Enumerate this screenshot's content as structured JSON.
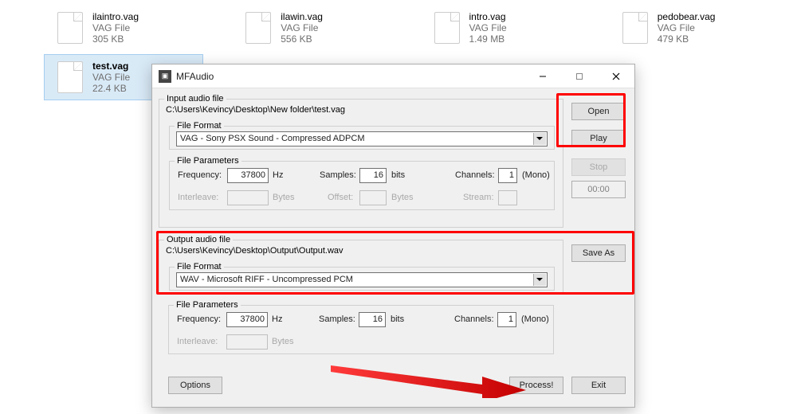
{
  "files": [
    {
      "name": "ilaintro.vag",
      "type": "VAG File",
      "size": "305 KB"
    },
    {
      "name": "ilawin.vag",
      "type": "VAG File",
      "size": "556 KB"
    },
    {
      "name": "intro.vag",
      "type": "VAG File",
      "size": "1.49 MB"
    },
    {
      "name": "pedobear.vag",
      "type": "VAG File",
      "size": "479 KB"
    },
    {
      "name": "test.vag",
      "type": "VAG File",
      "size": "22.4 KB"
    }
  ],
  "window": {
    "title": "MFAudio",
    "input": {
      "legend": "Input audio file",
      "path": "C:\\Users\\Kevincy\\Desktop\\New folder\\test.vag",
      "fileformat_legend": "File Format",
      "fileformat_value": "VAG - Sony PSX Sound - Compressed ADPCM",
      "params_legend": "File Parameters",
      "freq_label": "Frequency:",
      "freq_value": "37800",
      "freq_unit": "Hz",
      "samples_label": "Samples:",
      "samples_value": "16",
      "samples_unit": "bits",
      "channels_label": "Channels:",
      "channels_value": "1",
      "channels_unit": "(Mono)",
      "interleave_label": "Interleave:",
      "interleave_unit": "Bytes",
      "offset_label": "Offset:",
      "offset_unit": "Bytes",
      "stream_label": "Stream:"
    },
    "output": {
      "legend": "Output audio file",
      "path": "C:\\Users\\Kevincy\\Desktop\\Output\\Output.wav",
      "fileformat_legend": "File Format",
      "fileformat_value": "WAV - Microsoft RIFF - Uncompressed PCM",
      "params_legend": "File Parameters",
      "freq_label": "Frequency:",
      "freq_value": "37800",
      "freq_unit": "Hz",
      "samples_label": "Samples:",
      "samples_value": "16",
      "samples_unit": "bits",
      "channels_label": "Channels:",
      "channels_value": "1",
      "channels_unit": "(Mono)",
      "interleave_label": "Interleave:",
      "interleave_unit": "Bytes"
    },
    "buttons": {
      "open": "Open",
      "play": "Play",
      "stop": "Stop",
      "time": "00:00",
      "saveas": "Save As",
      "options": "Options",
      "process": "Process!",
      "exit": "Exit"
    }
  }
}
